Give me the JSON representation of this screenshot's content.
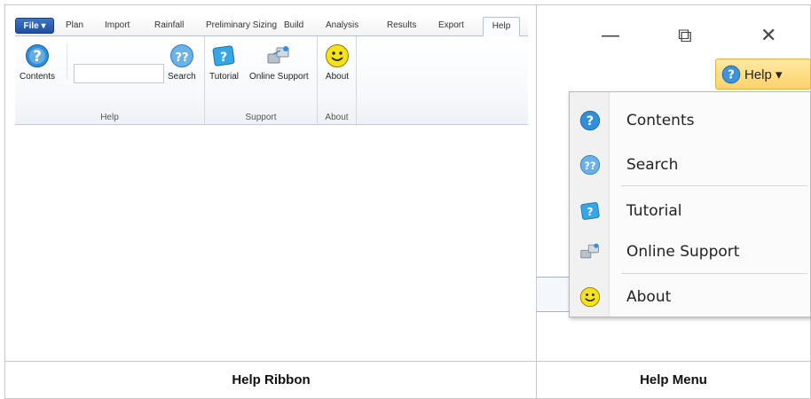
{
  "ribbon": {
    "file_label": "File ▾",
    "tabs": [
      "Plan",
      "Import",
      "Rainfall",
      "Preliminary Sizing",
      "Build",
      "Analysis",
      "Results",
      "Export"
    ],
    "active_tab": "Help",
    "groups": {
      "help": {
        "label": "Help",
        "contents_label": "Contents",
        "search_label": "Search",
        "search_value": ""
      },
      "support": {
        "label": "Support",
        "tutorial_label": "Tutorial",
        "online_support_label": "Online Support"
      },
      "about": {
        "label": "About",
        "about_label": "About"
      }
    }
  },
  "menu": {
    "window_controls": [
      "—",
      "⧉",
      "✕"
    ],
    "help_button_label": "Help ▾",
    "items": [
      {
        "label": "Contents",
        "icon": "contents-help-icon"
      },
      {
        "label": "Search",
        "icon": "search-help-icon"
      },
      {
        "label": "Tutorial",
        "icon": "tutorial-icon"
      },
      {
        "label": "Online Support",
        "icon": "online-support-icon"
      },
      {
        "label": "About",
        "icon": "smiley-icon"
      }
    ]
  },
  "captions": {
    "left": "Help Ribbon",
    "right": "Help Menu"
  },
  "colors": {
    "file_button": "#2a5fb3",
    "help_pill": "#fcd36b",
    "icon_blue": "#2f8fd8",
    "smiley_yellow": "#f5e21a"
  }
}
